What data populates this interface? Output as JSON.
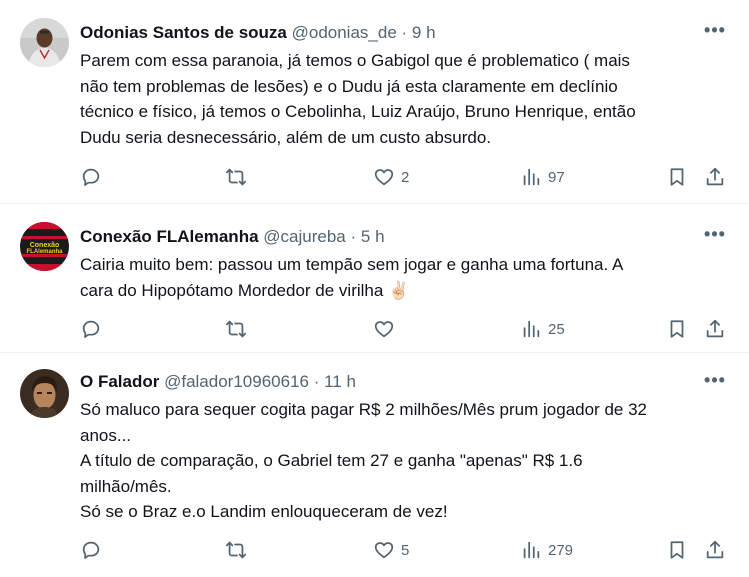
{
  "tweets": [
    {
      "name": "Odonias Santos de souza",
      "handle": "@odonias_de",
      "dot": "·",
      "time": "9 h",
      "text_lines": [
        "Parem com essa paranoia, já temos o Gabigol que é problematico ( mais",
        "não tem problemas de lesões) e o Dudu já esta claramente em declínio",
        "técnico e físico, já temos o Cebolinha, Luiz Araújo, Bruno Henrique, então",
        "Dudu seria desnecessário, além de um custo absurdo."
      ],
      "likes": "2",
      "views": "97",
      "avatar_colors": {
        "bg": "#c9c9c9",
        "skin": "#5a3b2a",
        "shirt": "#e8e8e8"
      }
    },
    {
      "name": "Conexão FLAlemanha",
      "handle": "@cajureba",
      "dot": "·",
      "time": "5 h",
      "text_lines": [
        "Cairia muito bem: passou um tempão sem jogar e ganha uma fortuna. A",
        "cara do Hipopótamo Mordedor de virilha"
      ],
      "emoji": "✌🏻",
      "likes": "",
      "views": "25",
      "avatar_text": [
        "Conexão",
        "FLAlemanha"
      ],
      "avatar_colors": {
        "bg": "#1a1a1a",
        "red": "#c8102e",
        "text": "#f2d024"
      }
    },
    {
      "name": "O Falador",
      "handle": "@falador10960616",
      "dot": "·",
      "time": "11 h",
      "text_paragraphs": [
        [
          "Só maluco para sequer cogita pagar R$ 2 milhões/Mês prum jogador de 32",
          "anos..."
        ],
        [
          "A título de comparação, o Gabriel tem 27 e ganha \"apenas\" R$ 1.6",
          "milhão/mês."
        ],
        [
          "Só se o Braz e.o Landim enlouqueceram de vez!"
        ]
      ],
      "likes": "5",
      "views": "279",
      "avatar_colors": {
        "bg": "#3b2c22",
        "skin": "#b8845c",
        "hair": "#2a1c12"
      }
    }
  ],
  "icons": {
    "more": "more-dots-icon",
    "reply": "reply-bubble-icon",
    "retweet": "retweet-arrows-icon",
    "like": "heart-icon",
    "views": "views-bar-chart-icon",
    "bookmark": "bookmark-icon",
    "share": "share-upload-icon"
  },
  "more_glyph": "•••"
}
